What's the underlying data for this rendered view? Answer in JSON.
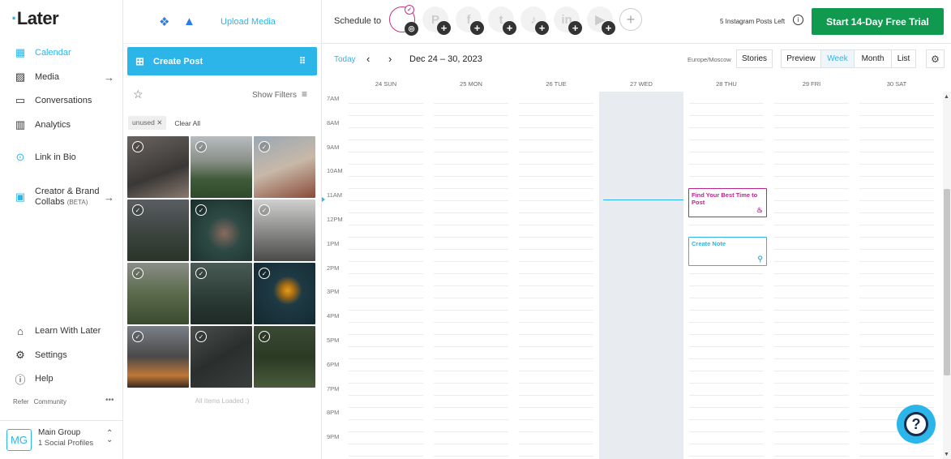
{
  "brand": {
    "logo": "Later",
    "accent": "#2cb5e8",
    "trial_color": "#109a4f"
  },
  "sidebar": {
    "items": [
      {
        "label": "Calendar",
        "icon": "calendar-icon",
        "active": true
      },
      {
        "label": "Media",
        "icon": "media-icon"
      },
      {
        "label": "Conversations",
        "icon": "chat-icon"
      },
      {
        "label": "Analytics",
        "icon": "analytics-icon"
      },
      {
        "label": "Link in Bio",
        "icon": "link-in-bio-icon"
      },
      {
        "label": "Creator & Brand",
        "label2": "Collabs",
        "beta": "(BETA)",
        "icon": "collabs-icon"
      },
      {
        "label": "Learn With Later",
        "icon": "learn-icon"
      },
      {
        "label": "Settings",
        "icon": "gear-icon"
      },
      {
        "label": "Help",
        "icon": "help-icon"
      }
    ],
    "refer": "Refer",
    "community": "Community",
    "group": {
      "initials": "MG",
      "name": "Main Group",
      "profiles": "1 Social Profiles"
    }
  },
  "media": {
    "upload": "Upload Media",
    "create_post": "Create Post",
    "show_filters": "Show Filters",
    "chip": "unused",
    "clear_all": "Clear All",
    "loaded": "All Items Loaded :)"
  },
  "calendar": {
    "schedule_to": "Schedule to",
    "posts_left": "5 Instagram Posts Left",
    "trial": "Start 14-Day Free Trial",
    "today": "Today",
    "range": "Dec 24 – 30, 2023",
    "timezone": "Europe/Moscow",
    "stories": "Stories",
    "views": [
      "Preview",
      "Week",
      "Month",
      "List"
    ],
    "active_view": "Week",
    "days": [
      "24 SUN",
      "25 MON",
      "26 TUE",
      "27 WED",
      "28 THU",
      "29 FRI",
      "30 SAT"
    ],
    "times": [
      "7AM",
      "8AM",
      "9AM",
      "10AM",
      "11AM",
      "12PM",
      "1PM",
      "2PM",
      "3PM",
      "4PM",
      "5PM",
      "6PM",
      "7PM",
      "8PM",
      "9PM"
    ],
    "events": [
      {
        "title": "Find Your Best Time to Post",
        "color": "#c1238e"
      },
      {
        "title": "Create Note",
        "color": "#2cb5e8"
      }
    ]
  }
}
